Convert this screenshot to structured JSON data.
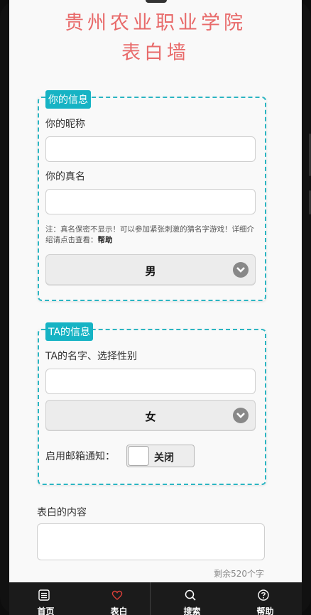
{
  "header": {
    "title_line1": "贵州农业职业学院",
    "title_line2": "表白墙"
  },
  "your_info": {
    "badge": "你的信息",
    "nickname_label": "你的昵称",
    "nickname_value": "",
    "realname_label": "你的真名",
    "realname_value": "",
    "note_text": "注：真名保密不显示！可以参加紧张刺激的猜名字游戏！详细介绍请点击查看：",
    "note_link": "帮助",
    "gender_selected": "男"
  },
  "ta_info": {
    "badge": "TA的信息",
    "name_label": "TA的名字、选择性别",
    "name_value": "",
    "gender_selected": "女",
    "email_label": "启用邮箱通知：",
    "email_toggle": "关闭"
  },
  "content": {
    "label": "表白的内容",
    "value": "",
    "remaining": "剩余520个字"
  },
  "tabbar": {
    "items": [
      {
        "label": "首页",
        "icon": "home-icon"
      },
      {
        "label": "表白",
        "icon": "heart-icon"
      },
      {
        "label": "搜索",
        "icon": "search-icon"
      },
      {
        "label": "帮助",
        "icon": "help-icon"
      }
    ]
  },
  "colors": {
    "title": "#e86a6a",
    "accent": "#16b3c4",
    "tabbar_bg": "#1b1b1b",
    "heart_active": "#e0403a"
  }
}
